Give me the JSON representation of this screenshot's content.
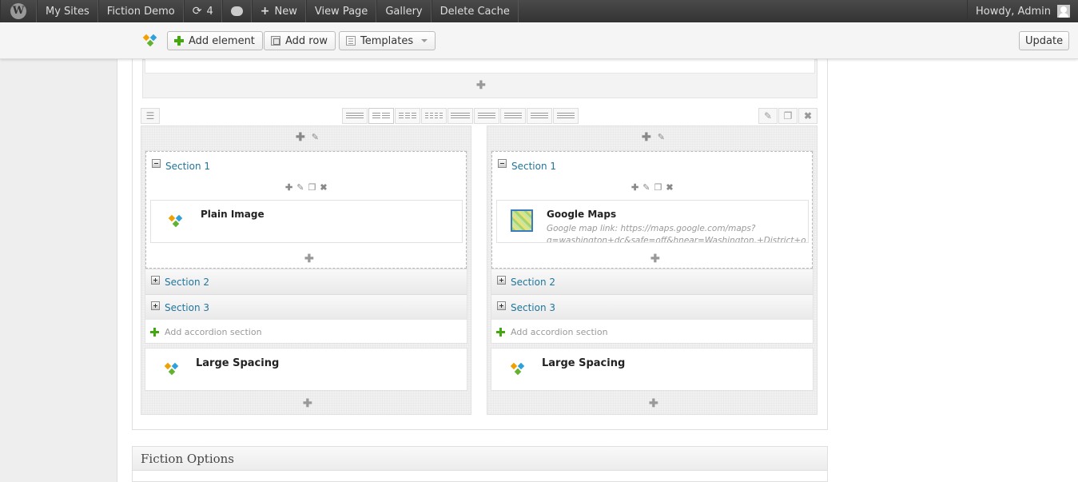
{
  "adminbar": {
    "my_sites": "My Sites",
    "site_name": "Fiction Demo",
    "updates_count": "4",
    "new_label": "New",
    "view_page": "View Page",
    "gallery": "Gallery",
    "delete_cache": "Delete Cache",
    "howdy": "Howdy, Admin"
  },
  "toolbar": {
    "add_element": "Add element",
    "add_row": "Add row",
    "templates": "Templates",
    "update": "Update"
  },
  "columns": [
    {
      "sections": [
        "Section 1",
        "Section 2",
        "Section 3"
      ],
      "element": {
        "name": "Plain Image",
        "description": ""
      },
      "add_accordion": "Add accordion section",
      "spacing": "Large Spacing"
    },
    {
      "sections": [
        "Section 1",
        "Section 2",
        "Section 3"
      ],
      "element": {
        "name": "Google Maps",
        "description": "Google map link: https://maps.google.com/maps?q=washington+dc&safe=off&hnear=Washington,+District+of+Columbia"
      },
      "add_accordion": "Add accordion section",
      "spacing": "Large Spacing"
    }
  ],
  "fiction_options": "Fiction Options",
  "colors": {
    "adminbar": "#464646",
    "link": "#21759b",
    "green": "#43a810"
  }
}
